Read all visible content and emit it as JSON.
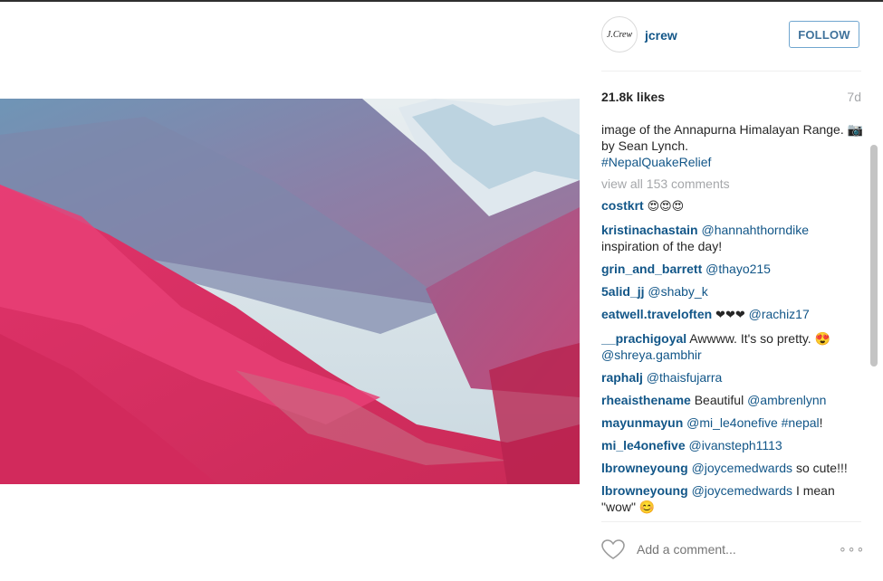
{
  "header": {
    "username": "jcrew",
    "avatar_text": "J.Crew",
    "follow_label": "FOLLOW"
  },
  "post": {
    "likes": "21.8k likes",
    "age": "7d",
    "caption_line": "image of the Annapurna Himalayan Range. 📷 by Sean Lynch.",
    "caption_hashtag": "#NepalQuakeRelief",
    "view_all": "view all 153 comments"
  },
  "comments": [
    {
      "user": "costkrt",
      "text": "",
      "mention": "",
      "tail": "😍😍😍"
    },
    {
      "user": "kristinachastain",
      "text": "",
      "mention": "@hannahthorndike",
      "tail": "inspiration of the day!"
    },
    {
      "user": "grin_and_barrett",
      "text": "",
      "mention": "@thayo215",
      "tail": ""
    },
    {
      "user": "5alid_jj",
      "text": "",
      "mention": "@shaby_k",
      "tail": ""
    },
    {
      "user": "eatwell.traveloften",
      "text": "❤❤❤",
      "mention": "@rachiz17",
      "tail": ""
    },
    {
      "user": "__prachigoyal",
      "text": "Awwww. It's so pretty. 😍",
      "mention": "@shreya.gambhir",
      "tail": ""
    },
    {
      "user": "raphalj",
      "text": "",
      "mention": "@thaisfujarra",
      "tail": ""
    },
    {
      "user": "rheaisthename",
      "text": "Beautiful",
      "mention": "@ambrenlynn",
      "tail": ""
    },
    {
      "user": "mayunmayun",
      "text": "",
      "mention": "@mi_le4onefive #nepal",
      "tail": "!"
    },
    {
      "user": "mi_le4onefive",
      "text": "",
      "mention": "@ivansteph1113",
      "tail": ""
    },
    {
      "user": "lbrowneyoung",
      "text": "",
      "mention": "@joycemedwards",
      "tail": "so cute!!!"
    },
    {
      "user": "lbrowneyoung",
      "text": "",
      "mention": "@joycemedwards",
      "tail": "I mean \"wow\" 😊"
    }
  ],
  "footer": {
    "add_comment_placeholder": "Add a comment...",
    "more_label": "∘∘∘"
  },
  "colors": {
    "link_blue": "#125688",
    "follow_border": "#70a6cf",
    "muted_gray": "#a5a7aa"
  },
  "icons": [
    "heart-icon",
    "more-options-icon"
  ]
}
